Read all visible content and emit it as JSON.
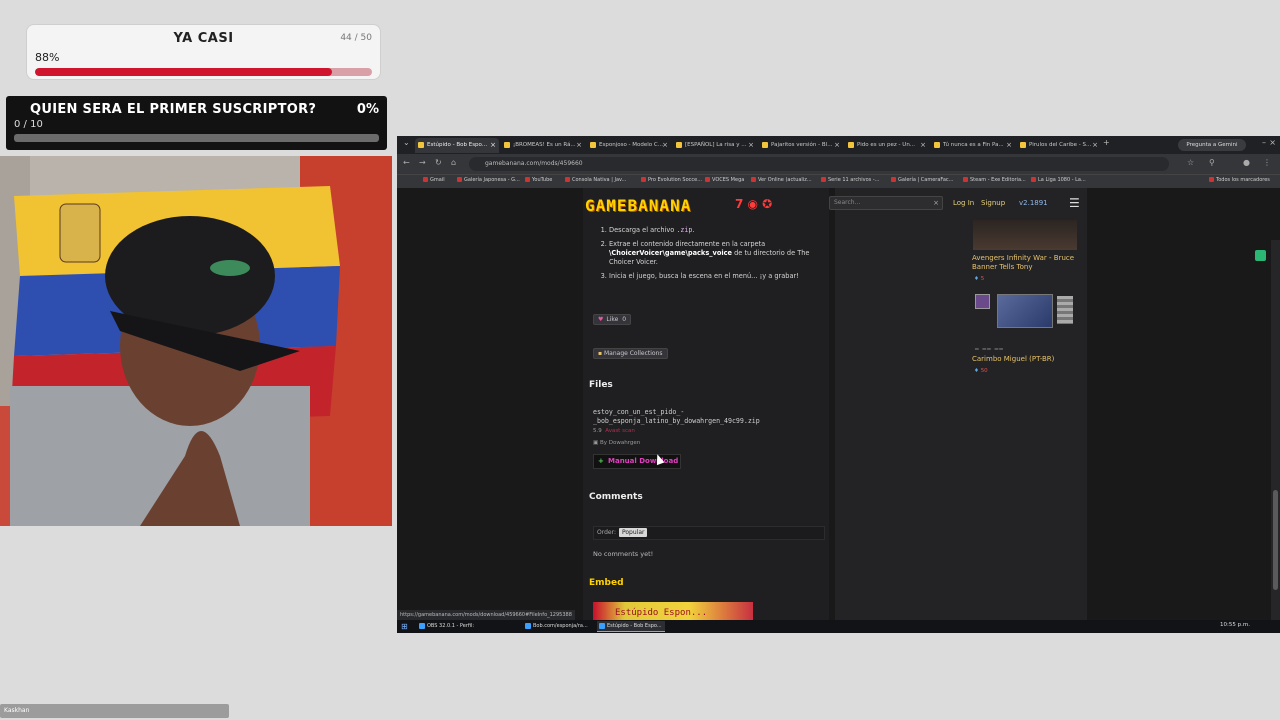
{
  "goal_primary": {
    "title": "YA CASI",
    "count": "44 / 50",
    "percent_label": "88%",
    "progress": 0.88
  },
  "goal_secondary": {
    "title": "QUIEN SERA EL PRIMER SUSCRIPTOR?",
    "percent_label": "0%",
    "count": "0 / 10",
    "progress": 0.0
  },
  "browser": {
    "tabs": [
      {
        "label": "Estúpido - Bob Espo..."
      },
      {
        "label": "¡BROMEAS! Es un Rá..."
      },
      {
        "label": "Esponjoso - Modelo C..."
      },
      {
        "label": "[ESPAÑOL] La risa y ..."
      },
      {
        "label": "Pajaritos versión - Bl..."
      },
      {
        "label": "Pido es un pez - Un..."
      },
      {
        "label": "Tú nunca es a Fin Pa..."
      },
      {
        "label": "Pirulos del Caribe - S..."
      }
    ],
    "gemini_label": "Pregunta a Gemini",
    "url": "gamebanana.com/mods/459660",
    "bookmarks": [
      "Gmail",
      "Galería Japonesa - G...",
      "YouTube",
      "Consola Nativa | Jav...",
      "Pro Evolution Socce...",
      "VOCES Mega",
      "Ver Online (actualiz...",
      "Serie 11 archivos -...",
      "Galería | CameraFac...",
      "Steam - Exe Editoria...",
      "La Liga 1080 - La..."
    ],
    "bookmarks_more": "Todos los marcadores",
    "status_url": "https://gamebanana.com/mods/download/459660#FileInfo_1295388"
  },
  "gamebanana": {
    "logo": "GAMEBANANA",
    "search_placeholder": "Search...",
    "login": "Log In",
    "signup": "Signup",
    "version": "v2.1891",
    "steps": {
      "s1_prefix": "Descarga el archivo",
      "s1_code": ".zip",
      "s2_prefix": "Extrae el contenido directamente en la carpeta",
      "s2_bold": "\\ChoicerVoicer\\game\\packs_voice",
      "s2_suffix": "de tu directorio de The Choicer Voicer.",
      "s3": "Inicia el juego, busca la escena en el menú... ¡y a grabar!"
    },
    "like_label": "Like",
    "like_count": "0",
    "manage_label": "Manage Collections",
    "files_heading": "Files",
    "filename": "estoy_con_un_est_pido_-_bob_esponja_latino_by_dowahrgen_49c99.zip",
    "file_meta_size": "5.9",
    "file_meta_status": "Avast scan",
    "file_meta_author": "By Dowahrgen",
    "download_label": "Manual Download",
    "comments_heading": "Comments",
    "order_label": "Order:",
    "order_value": "Popular",
    "no_comments": "No comments yet!",
    "embed_heading": "Embed",
    "embed_text": "Estúpido Espon...",
    "sidebar": {
      "item1_title": "Avengers Infinity War - Bruce Banner Tells Tony",
      "item1_stat": "5",
      "item2_title": "Carimbo Miguel (PT-BR)",
      "item2_stat": "50"
    }
  },
  "taskbar": {
    "items": [
      "OBS 32.0.1 - Perfil: Si...",
      "Bob.com/esponja/ra...",
      "Estúpido - Bob Espo..."
    ],
    "tray_time": "10:55 p.m."
  },
  "chat": {
    "text": "Kaskhan"
  }
}
